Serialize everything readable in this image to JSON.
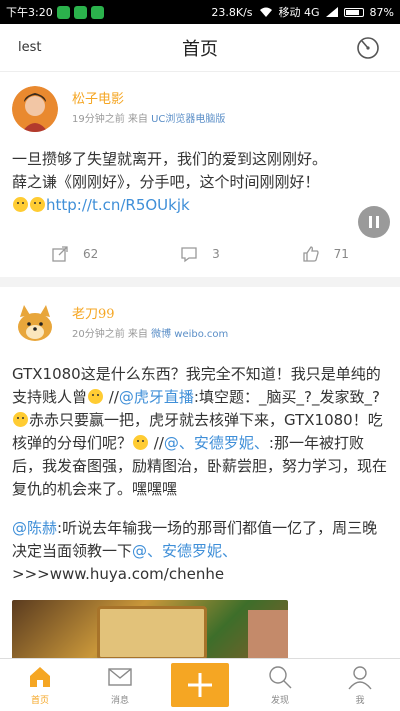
{
  "status_bar": {
    "time": "下午3:20",
    "speed": "23.8K/s",
    "carrier": "移动 4G",
    "battery": "87%",
    "battery_level": 0.87
  },
  "nav": {
    "left_label": "lest",
    "title": "首页",
    "right_icon": "radar-icon"
  },
  "posts": [
    {
      "name": "松子电影",
      "time": "19分钟之前 来自",
      "source": "UC浏览器电脑版",
      "text_line1": "一旦攒够了失望就离开，我们的爱到这刚刚好。",
      "text_line2": "薛之谦《刚刚好》，分手吧，这个时间刚刚好！",
      "link": "http://t.cn/R5OUkjk",
      "reposts": "62",
      "comments": "3",
      "likes": "71"
    },
    {
      "name": "老刀99",
      "time": "20分钟之前 来自",
      "source": "微博 weibo.com",
      "p1_a": "GTX1080这是什么东西？我完全不知道！我只是单纯的支持贱人曾",
      "p1_b": " //",
      "p1_mention1": "@虎牙直播",
      "p1_c": ":填空题：_脑买_?_发家致_? ",
      "p1_d": "赤赤只要赢一把，虎牙就去核弹下来，GTX1080！吃核弹的分母们呢？",
      "p1_e": " //",
      "p1_mention2": "@、安德罗妮、",
      "p1_f": ":那一年被打败后，我发奋图强，励精图治，卧薪尝胆，努力学习，现在复仇的机会来了。嘿嘿嘿",
      "p2_mention1": "@陈赫",
      "p2_a": ":听说去年输我一场的那哥们都值一亿了，周三晚决定当面领教一下",
      "p2_mention2": "@、安德罗妮、",
      "p2_b": ">>>www.huya.com/chenhe"
    }
  ],
  "tabs": [
    {
      "label": "首页",
      "icon": "home-icon"
    },
    {
      "label": "消息",
      "icon": "mail-icon"
    },
    {
      "label": "",
      "icon": "plus-icon"
    },
    {
      "label": "发现",
      "icon": "search-icon"
    },
    {
      "label": "我",
      "icon": "user-icon"
    }
  ],
  "colors": {
    "accent": "#f5a623",
    "link": "#3f8fd8"
  }
}
